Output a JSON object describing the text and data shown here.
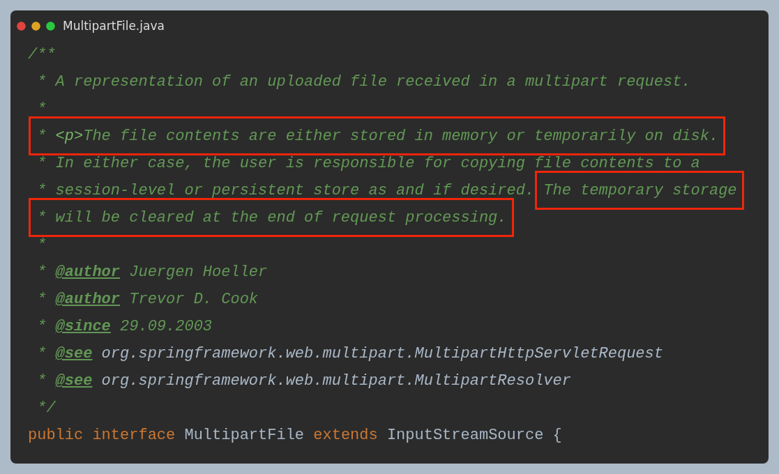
{
  "window": {
    "title": "MultipartFile.java"
  },
  "lines": [
    {
      "parts": [
        {
          "highlighted": false,
          "segments": [
            {
              "text": "/**",
              "kind": "comment"
            }
          ]
        }
      ]
    },
    {
      "parts": [
        {
          "highlighted": false,
          "segments": [
            {
              "text": " * A representation of an uploaded file received in a multipart request.",
              "kind": "comment"
            }
          ]
        }
      ]
    },
    {
      "parts": [
        {
          "highlighted": false,
          "segments": [
            {
              "text": " *",
              "kind": "comment"
            }
          ]
        }
      ]
    },
    {
      "parts": [
        {
          "highlighted": true,
          "segments": [
            {
              "text": " * ",
              "kind": "comment"
            },
            {
              "text": "<p>",
              "kind": "tag"
            },
            {
              "text": "The file contents are either stored in memory or temporarily on disk.",
              "kind": "comment"
            }
          ]
        }
      ]
    },
    {
      "parts": [
        {
          "highlighted": false,
          "segments": [
            {
              "text": " * In either case, the user is responsible for copying file contents to a",
              "kind": "comment"
            }
          ]
        }
      ]
    },
    {
      "parts": [
        {
          "highlighted": false,
          "segments": [
            {
              "text": " * session-level or persistent store as and if desired. ",
              "kind": "comment"
            }
          ]
        },
        {
          "highlighted": true,
          "segments": [
            {
              "text": "The temporary storage",
              "kind": "comment"
            }
          ]
        }
      ]
    },
    {
      "parts": [
        {
          "highlighted": true,
          "segments": [
            {
              "text": " * will be cleared at the end of request processing.",
              "kind": "comment"
            }
          ]
        }
      ]
    },
    {
      "parts": [
        {
          "highlighted": false,
          "segments": [
            {
              "text": " *",
              "kind": "comment"
            }
          ]
        }
      ]
    },
    {
      "parts": [
        {
          "highlighted": false,
          "segments": [
            {
              "text": " * ",
              "kind": "comment"
            },
            {
              "text": "@author",
              "kind": "doctag"
            },
            {
              "text": " Juergen Hoeller",
              "kind": "comment"
            }
          ]
        }
      ]
    },
    {
      "parts": [
        {
          "highlighted": false,
          "segments": [
            {
              "text": " * ",
              "kind": "comment"
            },
            {
              "text": "@author",
              "kind": "doctag"
            },
            {
              "text": " Trevor D. Cook",
              "kind": "comment"
            }
          ]
        }
      ]
    },
    {
      "parts": [
        {
          "highlighted": false,
          "segments": [
            {
              "text": " * ",
              "kind": "comment"
            },
            {
              "text": "@since",
              "kind": "doctag"
            },
            {
              "text": " 29.09.2003",
              "kind": "comment"
            }
          ]
        }
      ]
    },
    {
      "parts": [
        {
          "highlighted": false,
          "segments": [
            {
              "text": " * ",
              "kind": "comment"
            },
            {
              "text": "@see",
              "kind": "doctag"
            },
            {
              "text": " org.springframework.web.multipart.MultipartHttpServletRequest",
              "kind": "reference"
            }
          ]
        }
      ]
    },
    {
      "parts": [
        {
          "highlighted": false,
          "segments": [
            {
              "text": " * ",
              "kind": "comment"
            },
            {
              "text": "@see",
              "kind": "doctag"
            },
            {
              "text": " org.springframework.web.multipart.MultipartResolver",
              "kind": "reference"
            }
          ]
        }
      ]
    },
    {
      "parts": [
        {
          "highlighted": false,
          "segments": [
            {
              "text": " */",
              "kind": "comment"
            }
          ]
        }
      ]
    },
    {
      "parts": [
        {
          "highlighted": false,
          "segments": [
            {
              "text": "public interface",
              "kind": "keyword"
            },
            {
              "text": " MultipartFile ",
              "kind": "plain"
            },
            {
              "text": "extends",
              "kind": "keyword"
            },
            {
              "text": " InputStreamSource {",
              "kind": "plain"
            }
          ]
        }
      ]
    }
  ]
}
